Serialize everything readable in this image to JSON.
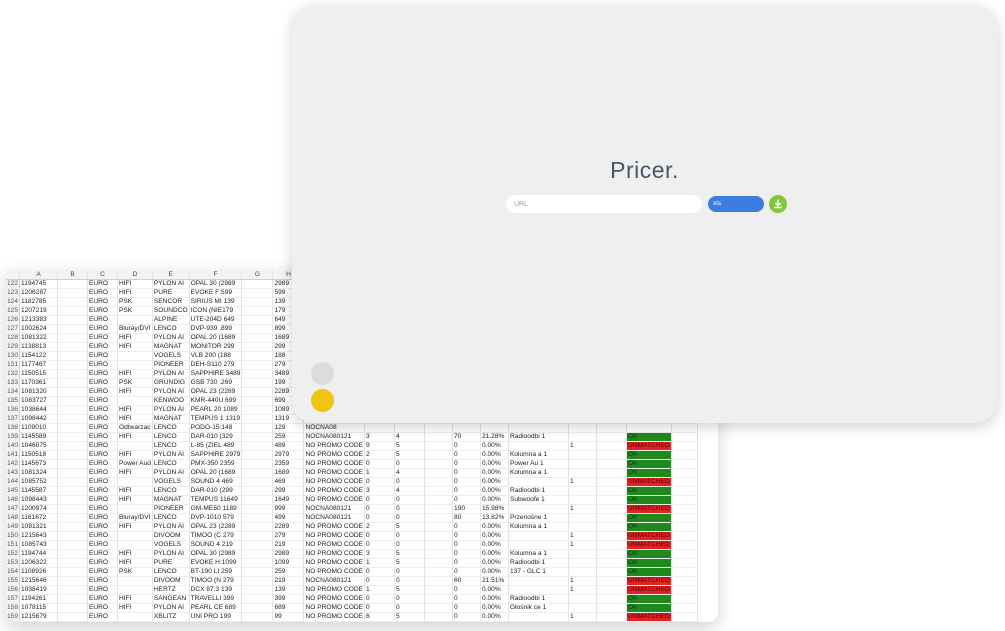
{
  "app": {
    "title": "Pricer."
  },
  "controls": {
    "url_placeholder": "URL",
    "url_value": "",
    "format_selected": "xls",
    "download_icon": "download-icon",
    "theme_light_icon": "moon-icon",
    "theme_dark_icon": "moon-icon"
  },
  "colors": {
    "accent_blue": "#3d7de0",
    "accent_green": "#7ec83a",
    "moon_yellow": "#f1c40f",
    "ok_green": "#1e8a1e",
    "unmatched_red": "#e02222"
  },
  "sheet": {
    "columns": [
      "",
      "A",
      "B",
      "C",
      "D",
      "E",
      "F",
      "G",
      "H",
      "I",
      "",
      "",
      "",
      "",
      "",
      "",
      "",
      "",
      "",
      ""
    ],
    "rows": [
      [
        "122",
        "1194745",
        "",
        "EURO",
        "HIFI",
        "PYLON AI",
        "OPAL 30 (2989",
        "",
        "2989",
        "NO PR",
        "",
        "",
        "",
        "",
        "",
        "",
        "",
        "",
        "",
        ""
      ],
      [
        "123",
        "1206287",
        "",
        "EURO",
        "HIFI",
        "PURE",
        "EVOKE F:599",
        "",
        "599",
        "NOCNA",
        "",
        "",
        "",
        "",
        "",
        "",
        "",
        "",
        "",
        ""
      ],
      [
        "124",
        "1182785",
        "",
        "EURO",
        "PSK",
        "SENCOR",
        "SIRIUS MI 139",
        "",
        "139",
        "NO PR",
        "",
        "",
        "",
        "",
        "",
        "",
        "",
        "",
        "",
        ""
      ],
      [
        "125",
        "1207219",
        "",
        "EURO",
        "PSK",
        "SOUNDCO",
        "ICON (NIE179",
        "",
        "179",
        "NO PR",
        "",
        "",
        "",
        "",
        "",
        "",
        "",
        "",
        "",
        ""
      ],
      [
        "126",
        "1213383",
        "",
        "EURO",
        "",
        "ALPINE",
        "UTE-204D 649",
        "",
        "649",
        "NO PR",
        "",
        "",
        "",
        "",
        "",
        "",
        "",
        "",
        "",
        ""
      ],
      [
        "127",
        "1002624",
        "",
        "EURO",
        "Bluray/DVI",
        "LENCO",
        "DVP-939 .899",
        "",
        "899",
        "NOCNA",
        "",
        "",
        "",
        "",
        "",
        "",
        "",
        "",
        "",
        ""
      ],
      [
        "128",
        "1081322",
        "",
        "EURO",
        "HIFI",
        "PYLON AI",
        "OPAL 20 (1689",
        "",
        "1689",
        "NO PR",
        "",
        "",
        "",
        "",
        "",
        "",
        "",
        "",
        "",
        ""
      ],
      [
        "129",
        "1138813",
        "",
        "EURO",
        "HIFI",
        "MAGNAT",
        "MONITOR 299",
        "",
        "299",
        "NO PR",
        "",
        "",
        "",
        "",
        "",
        "",
        "",
        "",
        "",
        ""
      ],
      [
        "130",
        "1154122",
        "",
        "EURO",
        "",
        "VOGELS",
        "VLB 200 (188",
        "",
        "188",
        "NO PR",
        "",
        "",
        "",
        "",
        "",
        "",
        "",
        "",
        "",
        ""
      ],
      [
        "131",
        "1177467",
        "",
        "EURO",
        "",
        "PIONEER",
        "DEH-S110 279",
        "",
        "279",
        "NO PR",
        "",
        "",
        "",
        "",
        "",
        "",
        "",
        "",
        "",
        ""
      ],
      [
        "132",
        "1150515",
        "",
        "EURO",
        "HIFI",
        "PYLON AI",
        "SAPPHIRE 3489",
        "",
        "3489",
        "NO PR",
        "",
        "",
        "",
        "",
        "",
        "",
        "",
        "",
        "",
        ""
      ],
      [
        "133",
        "1170361",
        "",
        "EURO",
        "PSK",
        "GRUNDIG",
        "GSB 730 .269",
        "",
        "199",
        "NOCNA",
        "",
        "",
        "",
        "",
        "",
        "",
        "",
        "",
        "",
        ""
      ],
      [
        "134",
        "1081320",
        "",
        "EURO",
        "HIFI",
        "PYLON AI",
        "OPAL 23 (2289",
        "",
        "2289",
        "NO PR",
        "",
        "",
        "",
        "",
        "",
        "",
        "",
        "",
        "",
        ""
      ],
      [
        "135",
        "1083727",
        "",
        "EURO",
        "",
        "KENWOO",
        "KMR-440U 699",
        "",
        "699",
        "NO PR",
        "",
        "",
        "",
        "",
        "",
        "",
        "",
        "",
        "",
        ""
      ],
      [
        "136",
        "1038644",
        "",
        "EURO",
        "HIFI",
        "PYLON AI",
        "PEARL 20 1089",
        "",
        "1089",
        "NO PR",
        "",
        "",
        "",
        "",
        "",
        "",
        "",
        "",
        "",
        ""
      ],
      [
        "137",
        "1098442",
        "",
        "EURO",
        "HIFI",
        "MAGNAT",
        "TEMPUS 1 1319",
        "",
        "1319",
        "NO PRO",
        "",
        "",
        "",
        "",
        "",
        "",
        "",
        "",
        "",
        ""
      ],
      [
        "138",
        "1109010",
        "",
        "EURO",
        "Odtwarzac",
        "LENCO",
        "PODO-15:148",
        "",
        "129",
        "NOCNA08",
        "",
        "",
        "",
        "",
        "",
        "",
        "",
        "",
        "",
        ""
      ],
      [
        "139",
        "1145589",
        "",
        "EURO",
        "HIFI",
        "LENCO",
        "DAR-010 (329",
        "",
        "259",
        "NOCNA080121",
        "3",
        "4",
        "",
        "70",
        "21.28%",
        "Radioodbi 1",
        "",
        "",
        "OK",
        ""
      ],
      [
        "140",
        "1046075",
        "",
        "EURO",
        "",
        "LENCO",
        "L-85 (ZIEL 489",
        "",
        "489",
        "NO PROMO CODE",
        "9",
        "5",
        "",
        "0",
        "0.00%",
        "",
        "1",
        "",
        "UNMATCHED",
        ""
      ],
      [
        "141",
        "1150518",
        "",
        "EURO",
        "HIFI",
        "PYLON AI",
        "SAPPHIRE 2979",
        "",
        "2979",
        "NO PROMO CODE",
        "2",
        "5",
        "",
        "0",
        "0.00%",
        "Kolumna a 1",
        "",
        "",
        "OK",
        ""
      ],
      [
        "142",
        "1145673",
        "",
        "EURO",
        "Power Aud",
        "LENCO",
        "PMX-350 2359",
        "",
        "2359",
        "NO PROMO CODE",
        "0",
        "0",
        "",
        "0",
        "0.00%",
        "Power Au 1",
        "",
        "",
        "OK",
        ""
      ],
      [
        "143",
        "1081324",
        "",
        "EURO",
        "HIFI",
        "PYLON AI",
        "OPAL 20 (1689",
        "",
        "1689",
        "NO PROMO CODE",
        "1",
        "4",
        "",
        "0",
        "0.00%",
        "Kolumna a 1",
        "",
        "",
        "OK",
        ""
      ],
      [
        "144",
        "1085752",
        "",
        "EURO",
        "",
        "VOGELS",
        "SOUND 4 469",
        "",
        "469",
        "NO PROMO CODE",
        "0",
        "0",
        "",
        "0",
        "0.00%",
        "",
        "1",
        "",
        "UNMATCHED",
        ""
      ],
      [
        "145",
        "1145587",
        "",
        "EURO",
        "HIFI",
        "LENCO",
        "DAR-010 (299",
        "",
        "299",
        "NO PROMO CODE",
        "3",
        "4",
        "",
        "0",
        "0.00%",
        "Radioodbi 1",
        "",
        "",
        "OK",
        ""
      ],
      [
        "146",
        "1098443",
        "",
        "EURO",
        "HIFI",
        "MAGNAT",
        "TEMPUS 11649",
        "",
        "1649",
        "NO PROMO CODE",
        "0",
        "0",
        "",
        "0",
        "0.00%",
        "Subwoofe 1",
        "",
        "",
        "OK",
        ""
      ],
      [
        "147",
        "1200974",
        "",
        "EURO",
        "",
        "PIONEER",
        "GM-ME50 1189",
        "",
        "999",
        "NOCNA080121",
        "0",
        "0",
        "",
        "190",
        "15.98%",
        "",
        "1",
        "",
        "UNMATCHED",
        ""
      ],
      [
        "148",
        "1161672",
        "",
        "EURO",
        "Bluray/DVI",
        "LENCO",
        "DVP-1010 579",
        "",
        "499",
        "NOCNA080121",
        "0",
        "0",
        "",
        "80",
        "13.82%",
        "Przenośne 1",
        "",
        "",
        "OK",
        ""
      ],
      [
        "149",
        "1081321",
        "",
        "EURO",
        "HIFI",
        "PYLON AI",
        "OPAL 23 (2289",
        "",
        "2289",
        "NO PROMO CODE",
        "2",
        "5",
        "",
        "0",
        "0.00%",
        "Kolumna a 1",
        "",
        "",
        "OK",
        ""
      ],
      [
        "150",
        "1215643",
        "",
        "EURO",
        "",
        "DIVOOM",
        "TIMOO (C 279",
        "",
        "279",
        "NO PROMO CODE",
        "0",
        "0",
        "",
        "0",
        "0.00%",
        "",
        "1",
        "",
        "UNMATCHED",
        ""
      ],
      [
        "151",
        "1085743",
        "",
        "EURO",
        "",
        "VOGELS",
        "SOUND 4 219",
        "",
        "219",
        "NO PROMO CODE",
        "0",
        "0",
        "",
        "0",
        "0.00%",
        "",
        "1",
        "",
        "UNMATCHED",
        ""
      ],
      [
        "152",
        "1194744",
        "",
        "EURO",
        "HIFI",
        "PYLON AI",
        "OPAL 30 (2989",
        "",
        "2989",
        "NO PROMO CODE",
        "3",
        "5",
        "",
        "0",
        "0.00%",
        "Kolumna a 1",
        "",
        "",
        "OK",
        ""
      ],
      [
        "153",
        "1206322",
        "",
        "EURO",
        "HIFI",
        "PURE",
        "EVOKE H:1099",
        "",
        "1099",
        "NO PROMO CODE",
        "1",
        "5",
        "",
        "0",
        "0.00%",
        "Radioodbi 1",
        "",
        "",
        "OK",
        ""
      ],
      [
        "154",
        "1108926",
        "",
        "EURO",
        "PSK",
        "LENCO",
        "BT-190 LI 259",
        "",
        "259",
        "NO PROMO CODE",
        "0",
        "0",
        "",
        "0",
        "0.00%",
        "137 - GLC 1",
        "",
        "",
        "OK",
        ""
      ],
      [
        "155",
        "1215646",
        "",
        "EURO",
        "",
        "DIVOOM",
        "TIMOO (N 279",
        "",
        "219",
        "NOCNA080121",
        "0",
        "0",
        "",
        "60",
        "21.51%",
        "",
        "1",
        "",
        "UNMATCHED",
        ""
      ],
      [
        "156",
        "1038419",
        "",
        "EURO",
        "",
        "HERTZ",
        "DCX 87.3 139",
        "",
        "139",
        "NO PROMO CODE",
        "1",
        "5",
        "",
        "0",
        "0.00%",
        "",
        "1",
        "",
        "UNMATCHED",
        ""
      ],
      [
        "157",
        "1194261",
        "",
        "EURO",
        "HIFI",
        "SANGEAN",
        "TRAVELLI 399",
        "",
        "399",
        "NO PROMO CODE",
        "0",
        "0",
        "",
        "0",
        "0.00%",
        "Radioodbi 1",
        "",
        "",
        "OK",
        ""
      ],
      [
        "158",
        "1078115",
        "",
        "EURO",
        "HIFI",
        "PYLON AI",
        "PEARL CE 689",
        "",
        "689",
        "NO PROMO CODE",
        "0",
        "0",
        "",
        "0",
        "0.00%",
        "Głośnik ce 1",
        "",
        "",
        "OK",
        ""
      ],
      [
        "159",
        "1215679",
        "",
        "EURO",
        "",
        "XBLITZ",
        "UNI PRO 199",
        "",
        "99",
        "NO PROMO CODE",
        "6",
        "5",
        "",
        "0",
        "0.00%",
        "",
        "1",
        "",
        "UNMATCHED",
        ""
      ],
      [
        "160",
        "1034499",
        "",
        "EURO",
        "MDR",
        "SONY",
        "MDR-RF8 189",
        "",
        "189",
        "NO PROMO CODE",
        "41",
        "4.5",
        "",
        "0",
        "0.00%",
        "Nauszne B 1",
        "",
        "",
        "OK",
        ""
      ],
      [
        "161",
        "1222443",
        "",
        "EURO",
        "",
        "XBLITZ",
        "BEAST PL 139",
        "",
        "139",
        "NO PROMO CODE",
        "4",
        "4",
        "",
        "0",
        "0.00%",
        "",
        "1",
        "",
        "UNMATCHED",
        ""
      ],
      [
        "162",
        "1215677",
        "",
        "EURO",
        "",
        "XBLITZ",
        "PURE BE 64",
        "",
        "64",
        "NO PROMO CODE",
        "32",
        "5",
        "",
        "0",
        "0.00%",
        "",
        "1",
        "",
        "UNMATCHED",
        ""
      ]
    ]
  }
}
